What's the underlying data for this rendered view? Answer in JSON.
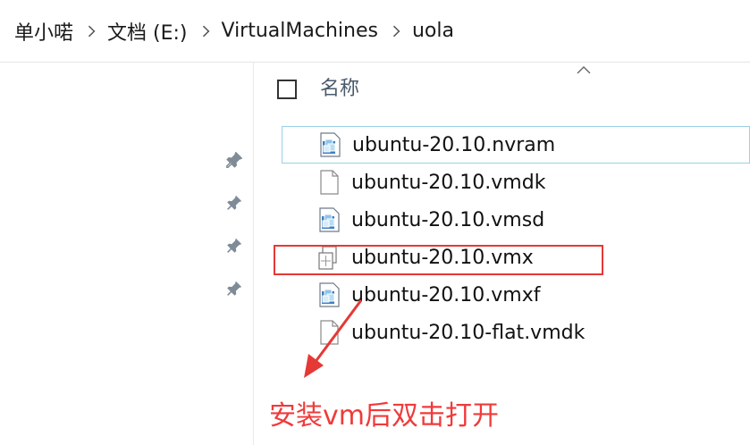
{
  "breadcrumb": {
    "items": [
      "单小喏",
      "文档 (E:)",
      "VirtualMachines",
      "uola"
    ]
  },
  "header": {
    "name_column": "名称"
  },
  "files": [
    {
      "name": "ubuntu-20.10.nvram",
      "icon": "vmware-file-icon"
    },
    {
      "name": "ubuntu-20.10.vmdk",
      "icon": "blank-file-icon"
    },
    {
      "name": "ubuntu-20.10.vmsd",
      "icon": "vmware-file-icon"
    },
    {
      "name": "ubuntu-20.10.vmx",
      "icon": "vmx-file-icon"
    },
    {
      "name": "ubuntu-20.10.vmxf",
      "icon": "vmware-file-icon"
    },
    {
      "name": "ubuntu-20.10-flat.vmdk",
      "icon": "blank-file-icon"
    }
  ],
  "annotation": {
    "text": "安装vm后双击打开",
    "color": "#f03a3a"
  },
  "colors": {
    "focus_border": "#99d1e4",
    "highlight": "#e53935"
  }
}
